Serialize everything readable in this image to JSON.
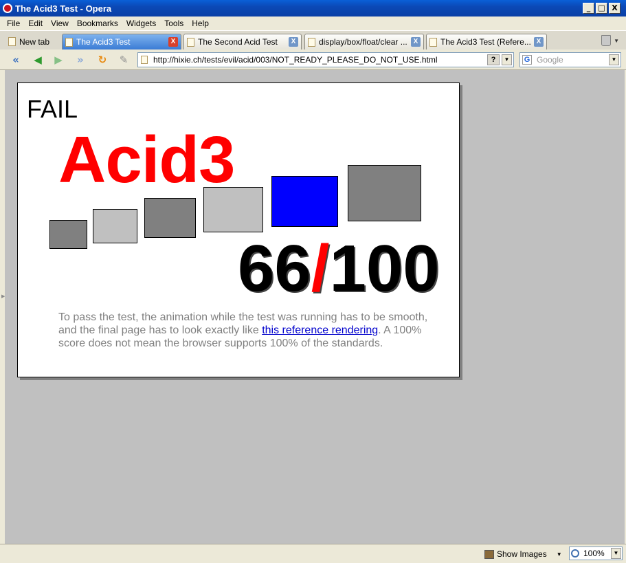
{
  "window": {
    "title": "The Acid3 Test - Opera",
    "controls": [
      "_",
      "□",
      "X"
    ]
  },
  "menu": [
    "File",
    "Edit",
    "View",
    "Bookmarks",
    "Widgets",
    "Tools",
    "Help"
  ],
  "tabs": {
    "new_tab": "New tab",
    "items": [
      {
        "label": "The Acid3 Test",
        "active": true
      },
      {
        "label": "The Second Acid Test",
        "active": false
      },
      {
        "label": "display/box/float/clear ...",
        "active": false
      },
      {
        "label": "The Acid3 Test (Refere...",
        "active": false
      }
    ],
    "close_glyph": "X"
  },
  "nav": {
    "url": "http://hixie.ch/tests/evil/acid/003/NOT_READY_PLEASE_DO_NOT_USE.html",
    "help_glyph": "?",
    "search_placeholder": "Google"
  },
  "page": {
    "status_word": "FAIL",
    "title": "Acid3",
    "score_num": "66",
    "score_slash": "/",
    "score_total": "100",
    "desc_before": "To pass the test, the animation while the test was running has to be smooth, and the final page has to look exactly like ",
    "desc_link": "this reference rendering",
    "desc_after": ". A 100% score does not mean the browser supports 100% of the standards.",
    "bucket_colors": [
      "#808080",
      "#c0c0c0",
      "#808080",
      "#c0c0c0",
      "#0000ff",
      "#808080"
    ]
  },
  "status": {
    "show_images": "Show Images",
    "zoom": "100%"
  },
  "colors": {
    "fail_red": "#ff0000",
    "link": "#0000cc",
    "viewport_bg": "#c0c0c0"
  }
}
